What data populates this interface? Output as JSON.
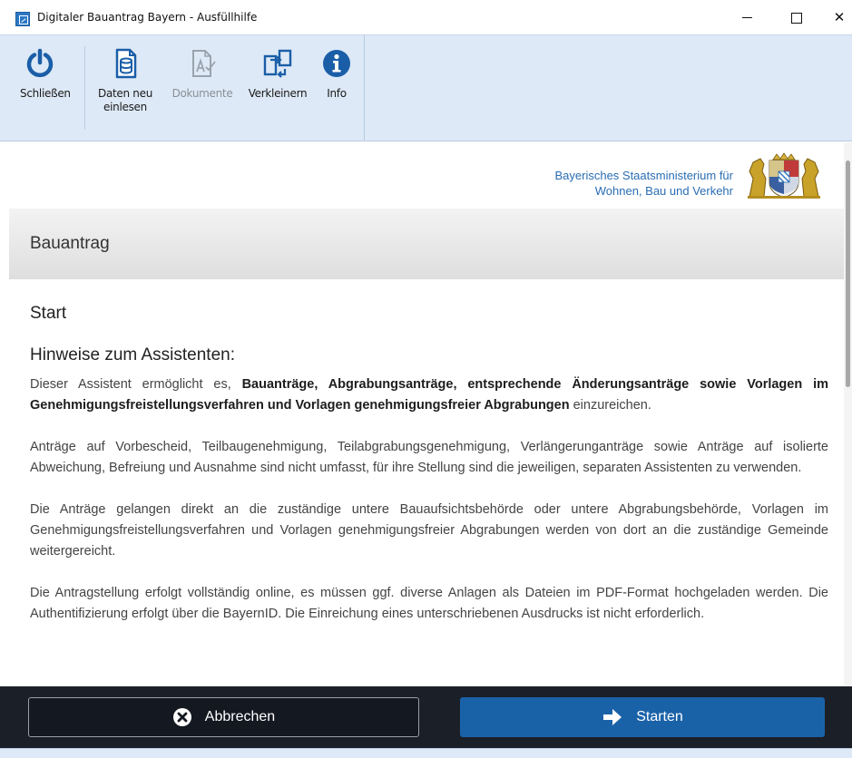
{
  "window": {
    "title": "Digitaler Bauantrag Bayern - Ausfüllhilfe",
    "close_glyph": "✕"
  },
  "toolbar": {
    "close_label": "Schließen",
    "reload_label_1": "Daten neu",
    "reload_label_2": "einlesen",
    "documents_label": "Dokumente",
    "shrink_label": "Verkleinern",
    "info_label": "Info",
    "icon_color": "#1a5ea8",
    "disabled_color": "#9aa3ad"
  },
  "header": {
    "ministry_line_1": "Bayerisches Staatsministerium für",
    "ministry_line_2": "Wohnen, Bau und Verkehr"
  },
  "section": {
    "title": "Bauantrag"
  },
  "main": {
    "step_title": "Start",
    "hints_title": "Hinweise zum Assistenten:",
    "p1_start": "Dieser Assistent ermöglicht es, ",
    "p1_bold": "Bauanträge, Abgrabungsanträge, entsprechende Änderungsanträge sowie Vorlagen im Genehmigungsfreistellungsverfahren und Vorlagen genehmigungsfreier Abgrabungen",
    "p1_end": " einzurei­chen.",
    "p2": "Anträge auf Vorbescheid, Teilbaugenehmigung, Teilabgrabungsgenehmigung, Verlängerunganträge sowie An­träge auf isolierte Abweichung, Befreiung und Ausnahme sind nicht umfasst, für ihre Stellung sind die jeweili­gen, separaten Assistenten zu verwenden.",
    "p3": "Die Anträge gelangen direkt an die zuständige untere Bauaufsichtsbehörde oder untere Abgrabungsbehörde, Vorlagen im Genehmigungsfreistellungsverfahren und Vorlagen genehmigungsfreier Abgrabungen werden von dort an die zuständige Gemeinde weitergereicht.",
    "p4": "Die Antragstellung erfolgt vollständig online, es müssen ggf. diverse Anlagen als Dateien im PDF-Format hoch­geladen werden. Die Authentifizierung erfolgt über die BayernID. Die Einreichung eines unterschriebenen Aus­drucks ist nicht erforderlich."
  },
  "actions": {
    "cancel_label": "Abbrechen",
    "start_label": "Starten",
    "start_color": "#1a62a8"
  }
}
